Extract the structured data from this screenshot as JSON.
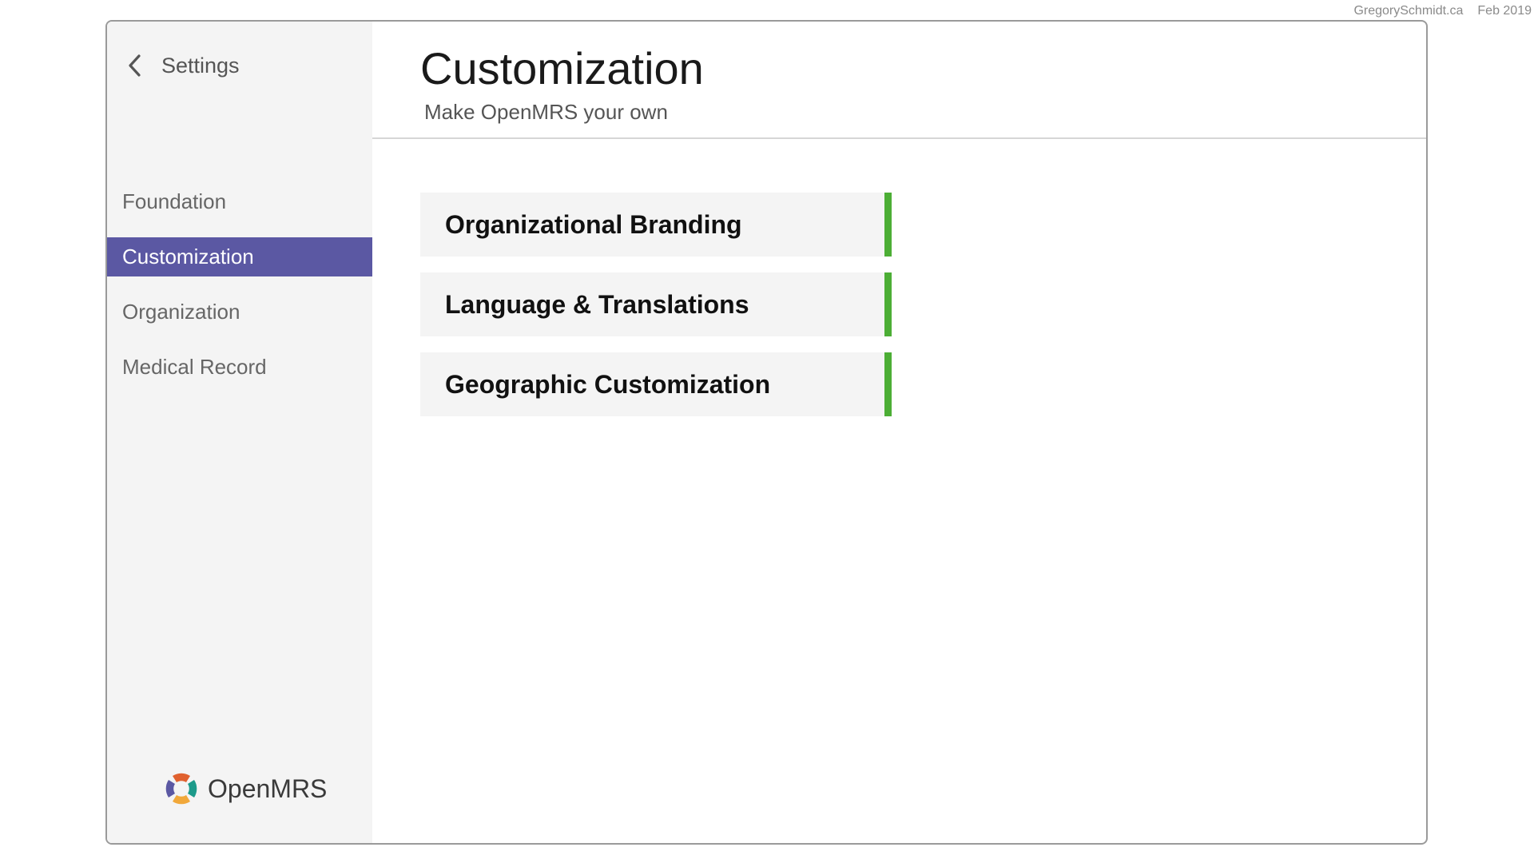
{
  "credit": {
    "site": "GregorySchmidt.ca",
    "date": "Feb 2019"
  },
  "sidebar": {
    "back_label": "Settings",
    "back_icon": "chevron-left-icon",
    "items": [
      {
        "label": "Foundation",
        "active": false
      },
      {
        "label": "Customization",
        "active": true
      },
      {
        "label": "Organization",
        "active": false
      },
      {
        "label": "Medical Record",
        "active": false
      }
    ],
    "logo_text": "OpenMRS",
    "active_color": "#5b58a3"
  },
  "main": {
    "title": "Customization",
    "subtitle": "Make OpenMRS your own",
    "cards": [
      {
        "label": "Organizational Branding"
      },
      {
        "label": "Language & Translations"
      },
      {
        "label": "Geographic Customization"
      }
    ],
    "card_accent_color": "#4cae35"
  }
}
